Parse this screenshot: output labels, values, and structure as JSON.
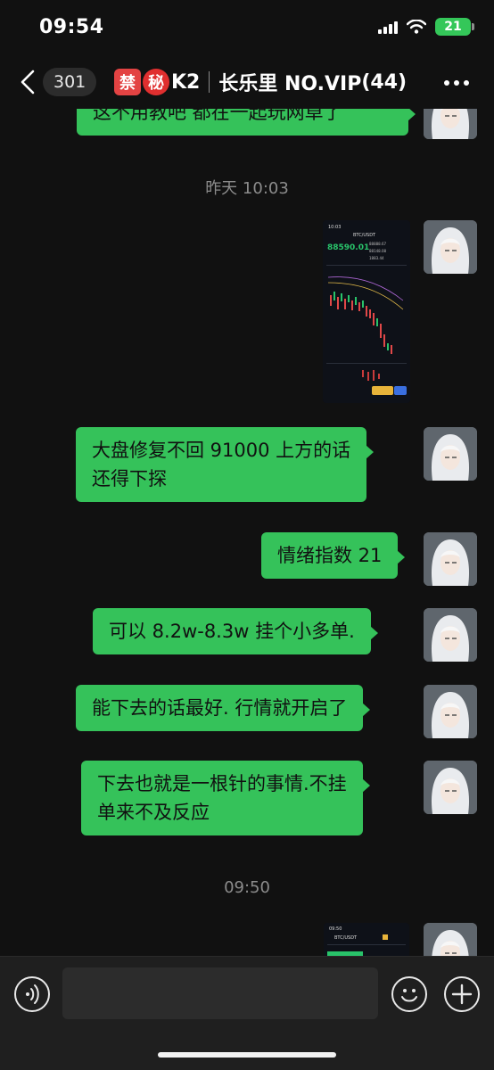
{
  "status_bar": {
    "time": "09:54",
    "battery": "21"
  },
  "header": {
    "unread_count": "301",
    "tag_1": "禁",
    "tag_2": "秘",
    "name_prefix": "K2",
    "group_name": "长乐里 NO.VIP",
    "member_count": "(44)"
  },
  "messages": {
    "partial_top": "这不用教吧  都在一起玩网卓了",
    "time_1": "昨天 10:03",
    "shot_1": {
      "time": "10:03",
      "pair": "BTC/USDT",
      "price": "88590.01",
      "stats_1": "88888.67",
      "stats_2": "88148.08",
      "stats_3": "1883.44"
    },
    "msg_1_line_1": "大盘修复不回 91000 上方的话",
    "msg_1_line_2": "还得下探",
    "msg_2": "情绪指数 21",
    "msg_3": "可以 8.2w-8.3w 挂个小多单.",
    "msg_4": "能下去的话最好. 行情就开启了",
    "msg_5_line_1": "下去也就是一根针的事情.不挂",
    "msg_5_line_2": "单来不及反应",
    "time_2": "09:50",
    "shot_2": {
      "time": "09:50",
      "pair": "BTC/USDT"
    }
  },
  "input": {
    "placeholder": ""
  },
  "colors": {
    "bubble": "#35c25a",
    "background": "#111111",
    "battery": "#34c759",
    "tag": "#e02f2f"
  }
}
